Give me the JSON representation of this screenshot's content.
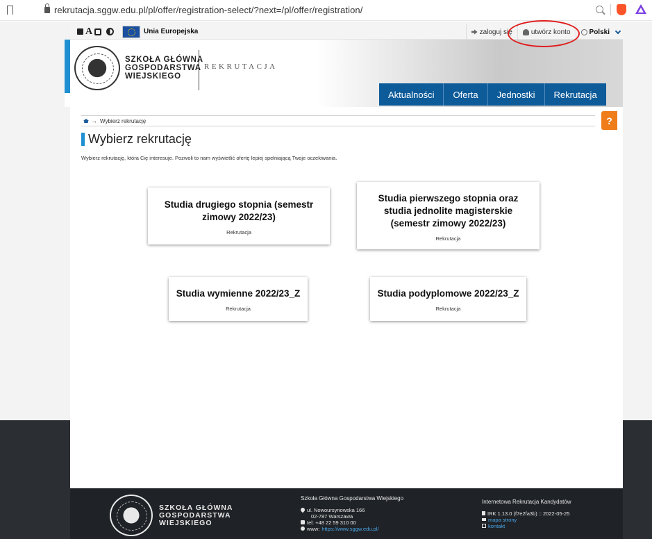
{
  "browser": {
    "url": "rekrutacja.sggw.edu.pl/pl/offer/registration-select/?next=/pl/offer/registration/"
  },
  "utility": {
    "eu_label": "Unia Europejska",
    "acc_letter": "A",
    "login": "zaloguj się",
    "create_account": "utwórz konto",
    "language": "Polski"
  },
  "header": {
    "name_line1": "SZKOŁA GŁÓWNA",
    "name_line2": "GOSPODARSTWA",
    "name_line3": "WIEJSKIEGO",
    "subtitle": "REKRUTACJA"
  },
  "nav": {
    "items": [
      "Aktualności",
      "Oferta",
      "Jednostki",
      "Rekrutacja"
    ]
  },
  "breadcrumb": {
    "current": "Wybierz rekrutację",
    "arrow": "→"
  },
  "help_label": "?",
  "page": {
    "title": "Wybierz rekrutację",
    "description": "Wybierz rekrutację, która Cię interesuje. Pozwoli to nam wyświetlić ofertę lepiej spełniającą Twoje oczekiwania."
  },
  "cards": [
    {
      "title": "Studia drugiego stopnia (semestr zimowy 2022/23)",
      "subtitle": "Rekrutacja"
    },
    {
      "title": "Studia pierwszego stopnia oraz studia jednolite magisterskie (semestr zimowy 2022/23)",
      "subtitle": "Rekrutacja"
    },
    {
      "title": "Studia wymienne 2022/23_Z",
      "subtitle": "Rekrutacja"
    },
    {
      "title": "Studia podyplomowe 2022/23_Z",
      "subtitle": "Rekrutacja"
    }
  ],
  "footer": {
    "name_line1": "SZKOŁA GŁÓWNA",
    "name_line2": "GOSPODARSTWA",
    "name_line3": "WIEJSKIEGO",
    "contact_head": "Szkoła Główna Gospodarstwa Wiejskiego",
    "address_line1": "ul. Nowoursynowska 166",
    "address_line2": "02-787 Warszawa",
    "phone": "tel: +48 22 59 310 00",
    "www_label": "www:",
    "www_link": "https://www.sggw.edu.pl/",
    "system_head": "Internetowa Rekrutacja Kandydatów",
    "version": "IRK 1.13.0 (f7e2fa3b) :: 2022-05-25",
    "sitemap": "mapa strony",
    "contact": "kontakt"
  },
  "colors": {
    "nav_blue": "#0e5b9a",
    "accent_blue": "#1e8fd1",
    "help_orange": "#ef7d1a",
    "highlight_red": "#e01e1e"
  }
}
